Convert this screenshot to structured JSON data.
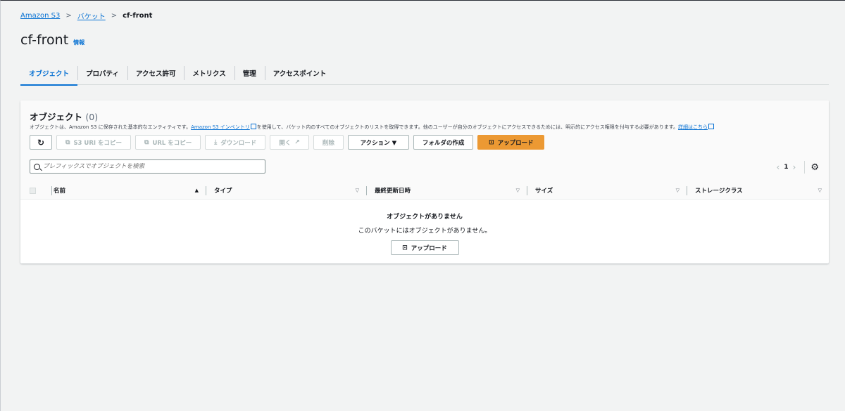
{
  "breadcrumb": {
    "s3": "Amazon S3",
    "buckets": "バケット",
    "current": "cf-front"
  },
  "page": {
    "title": "cf-front",
    "info": "情報"
  },
  "tabs": [
    "オブジェクト",
    "プロパティ",
    "アクセス許可",
    "メトリクス",
    "管理",
    "アクセスポイント"
  ],
  "objects": {
    "title": "オブジェクト",
    "count": "(0)",
    "desc_pre": "オブジェクトは、Amazon S3 に保存された基本的なエンティティです。",
    "desc_link1": "Amazon S3 インベントリ",
    "desc_mid": "を使用して、バケット内のすべてのオブジェクトのリストを取得できます。他のユーザーが自分のオブジェクトにアクセスできるためには、明示的にアクセス権限を付与する必要があります。",
    "desc_link2": "詳細はこちら"
  },
  "toolbar": {
    "refresh": "↻",
    "copy_s3_uri": "S3 URI をコピー",
    "copy_url": "URL をコピー",
    "download": "ダウンロード",
    "open": "開く",
    "delete": "削除",
    "actions": "アクション ▼",
    "create_folder": "フォルダの作成",
    "upload": "アップロード"
  },
  "search": {
    "placeholder": "プレフィックスでオブジェクトを検索"
  },
  "pager": {
    "page": "1"
  },
  "columns": [
    "名前",
    "タイプ",
    "最終更新日時",
    "サイズ",
    "ストレージクラス"
  ],
  "empty": {
    "title": "オブジェクトがありません",
    "subtitle": "このバケットにはオブジェクトがありません。",
    "upload": "アップロード"
  }
}
